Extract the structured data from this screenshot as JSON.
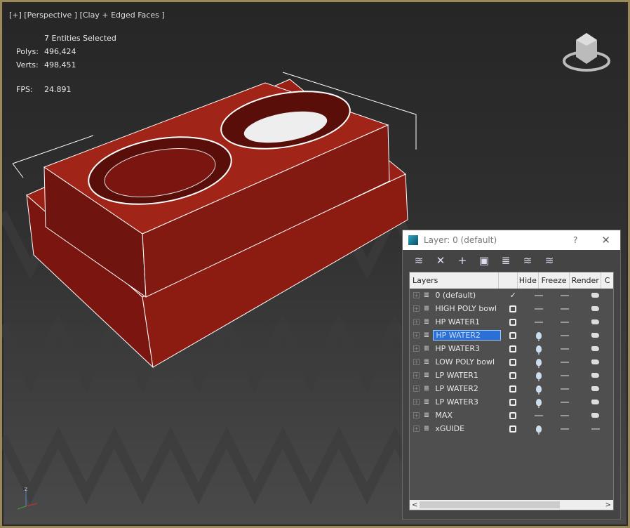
{
  "viewport": {
    "label": "[+] [Perspective ] [Clay + Edged Faces ]",
    "stats": {
      "selection": "7 Entities Selected",
      "polys_label": "Polys:",
      "polys": "496,424",
      "verts_label": "Verts:",
      "verts": "498,451",
      "fps_label": "FPS:",
      "fps": "24.891"
    },
    "colors": {
      "model": "#8a1a12",
      "border": "#9a8a5a",
      "stats": "#e8d070"
    }
  },
  "dialog": {
    "title": "Layer: 0 (default)",
    "help": "?",
    "close": "✕",
    "toolbar": [
      "create-layer",
      "delete-layer",
      "add-to-layer",
      "select-objects",
      "select-layer",
      "set-current",
      "layer-settings"
    ],
    "columns": [
      "Layers",
      "",
      "Hide",
      "Freeze",
      "Render",
      "C"
    ],
    "layers": [
      {
        "name": "0 (default)",
        "current": "check",
        "hide": "dash",
        "freeze": "dash",
        "render": "teapot"
      },
      {
        "name": "HIGH POLY bowl",
        "current": "box",
        "hide": "dash",
        "freeze": "dash",
        "render": "teapot"
      },
      {
        "name": "HP WATER1",
        "current": "box",
        "hide": "dash",
        "freeze": "dash",
        "render": "teapot"
      },
      {
        "name": "HP WATER2",
        "current": "box",
        "hide": "bulb",
        "freeze": "dash",
        "render": "teapot",
        "selected": true
      },
      {
        "name": "HP WATER3",
        "current": "box",
        "hide": "bulb",
        "freeze": "dash",
        "render": "teapot"
      },
      {
        "name": "LOW POLY bowl",
        "current": "box",
        "hide": "bulb",
        "freeze": "dash",
        "render": "teapot"
      },
      {
        "name": "LP WATER1",
        "current": "box",
        "hide": "bulb",
        "freeze": "dash",
        "render": "teapot"
      },
      {
        "name": "LP WATER2",
        "current": "box",
        "hide": "bulb",
        "freeze": "dash",
        "render": "teapot"
      },
      {
        "name": "LP WATER3",
        "current": "box",
        "hide": "bulb",
        "freeze": "dash",
        "render": "teapot"
      },
      {
        "name": "MAX",
        "current": "box",
        "hide": "dash",
        "freeze": "dash",
        "render": "teapot"
      },
      {
        "name": "xGUIDE",
        "current": "box",
        "hide": "bulb",
        "freeze": "dash",
        "render": "dash"
      }
    ],
    "scroll_left": "<",
    "scroll_right": ">"
  }
}
